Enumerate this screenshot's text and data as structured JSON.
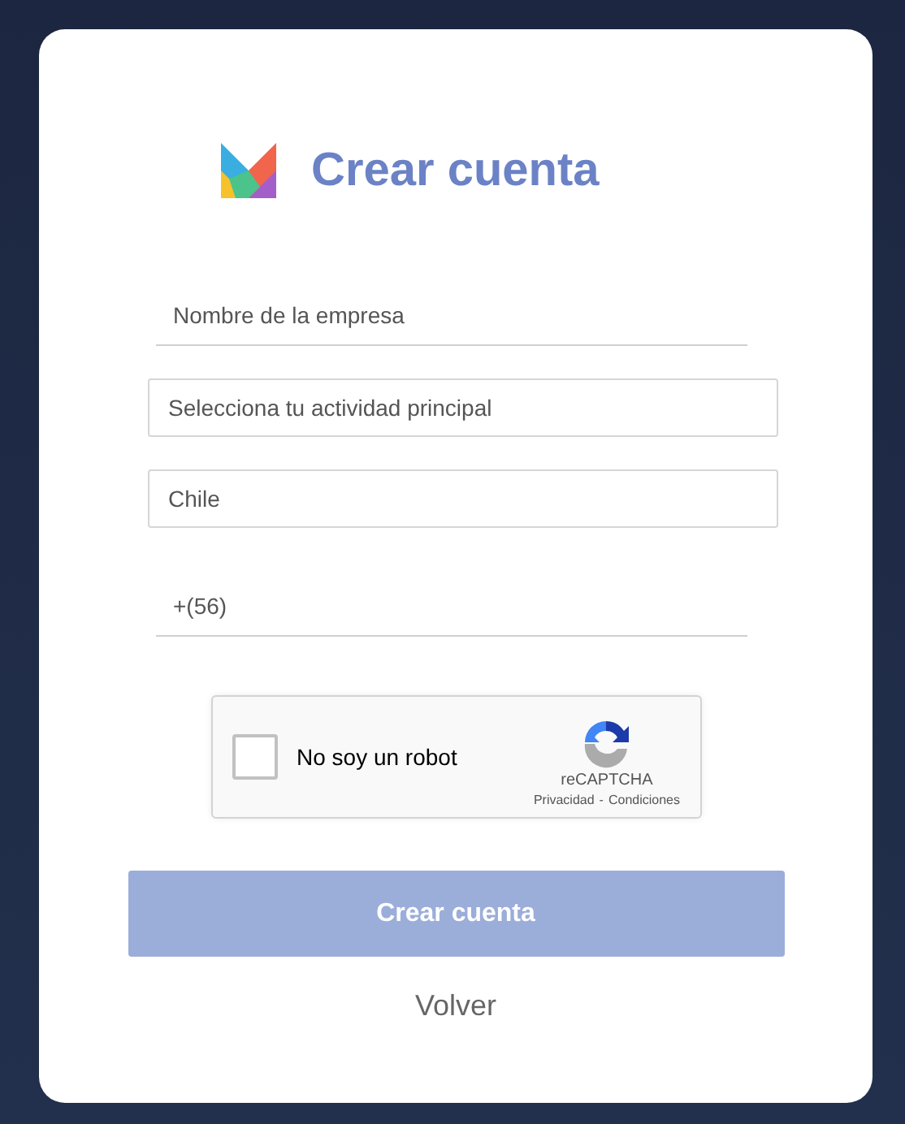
{
  "title": "Crear cuenta",
  "fields": [
    {
      "kind": "underline",
      "placeholder": "Nombre de la empresa"
    },
    {
      "kind": "boxed",
      "placeholder": "Selecciona tu actividad principal"
    },
    {
      "kind": "boxed",
      "value": "Chile"
    },
    {
      "kind": "underline",
      "value": "+(56)"
    }
  ],
  "captcha": {
    "label": "No soy un robot",
    "checked": false,
    "brand": "reCAPTCHA",
    "links": [
      "Privacidad",
      "Condiciones"
    ],
    "separator": "-"
  },
  "submit": {
    "label": "Crear cuenta",
    "disabled": true
  },
  "back": {
    "label": "Volver"
  }
}
